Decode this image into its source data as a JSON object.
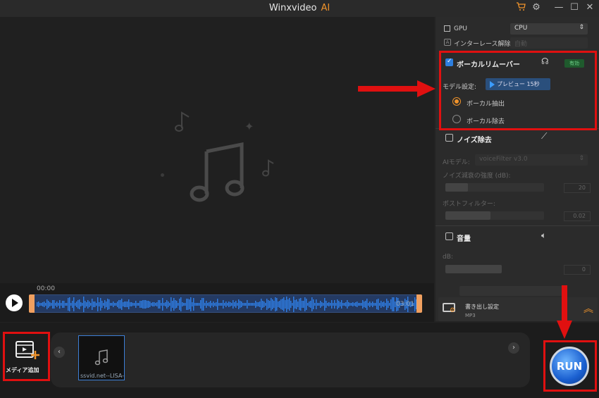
{
  "app": {
    "title": "Winxvideo",
    "title_ai": "AI"
  },
  "window": {
    "icons": [
      "cart-icon",
      "gear-icon",
      "minimize-icon",
      "maximize-icon",
      "close-icon"
    ]
  },
  "timeline": {
    "start_time": "00:00",
    "end_time": "03:01"
  },
  "panel": {
    "gpu_label": "GPU",
    "gpu_value": "CPU",
    "deinterlace_label": "インターレース解除",
    "deinterlace_value": "自動",
    "vocal": {
      "title": "ボーカルリムーバー",
      "enabled": true,
      "badge": "有効",
      "model_label": "モデル設定:",
      "preview_button": "プレビュー 15秒",
      "options": [
        "ボーカル抽出",
        "ボーカル除去"
      ],
      "selected": "ボーカル抽出"
    },
    "noise": {
      "title": "ノイズ除去",
      "enabled": false,
      "ai_model_label": "AIモデル:",
      "ai_model_value": "voiceFilter v3.0",
      "reduction_label": "ノイズ減衰の強度 (dB):",
      "reduction_value": "20",
      "postfilter_label": "ポストフィルター:",
      "postfilter_value": "0.02"
    },
    "volume": {
      "title": "音量",
      "enabled": false,
      "db_label": "dB:",
      "db_value": "0"
    },
    "output": {
      "label": "書き出し設定",
      "format": "MP3"
    }
  },
  "media": {
    "add_label": "メディア追加",
    "file_name": "ssvid.net--LISA-J"
  },
  "run_label": "RUN",
  "colors": {
    "accent": "#f0932b",
    "annotation": "#e01010",
    "active_blue": "#2d7fe0"
  }
}
